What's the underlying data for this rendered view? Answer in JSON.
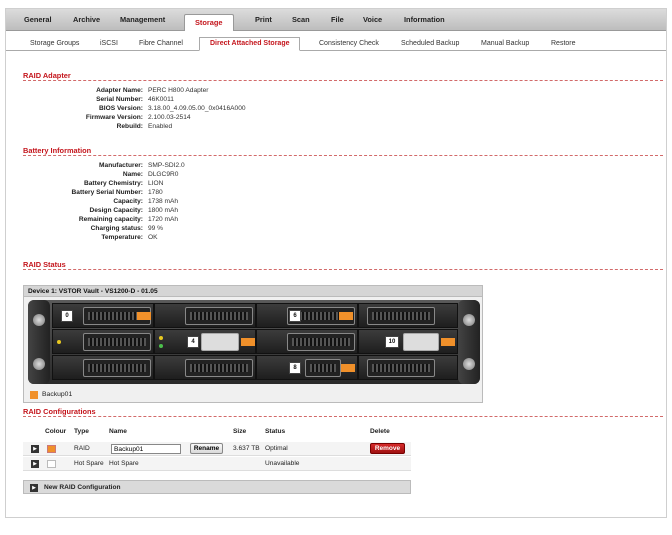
{
  "topnav": {
    "tabs": [
      "General",
      "Archive",
      "Management",
      "Storage",
      "Print",
      "Scan",
      "File",
      "Voice",
      "Information"
    ],
    "active": "Storage"
  },
  "subnav": {
    "tabs": [
      "Storage Groups",
      "iSCSI",
      "Fibre Channel",
      "Direct Attached Storage",
      "Consistency Check",
      "Scheduled Backup",
      "Manual Backup",
      "Restore"
    ],
    "active": "Direct Attached Storage"
  },
  "raid_adapter": {
    "title": "RAID Adapter",
    "rows": [
      {
        "label": "Adapter Name:",
        "value": "PERC H800 Adapter"
      },
      {
        "label": "Serial Number:",
        "value": "46K0011"
      },
      {
        "label": "BIOS Version:",
        "value": "3.18.00_4.09.05.00_0x0416A000"
      },
      {
        "label": "Firmware Version:",
        "value": "2.100.03-2514"
      },
      {
        "label": "Rebuild:",
        "value": "Enabled"
      }
    ]
  },
  "battery": {
    "title": "Battery Information",
    "rows": [
      {
        "label": "Manufacturer:",
        "value": "SMP-SDI2.0"
      },
      {
        "label": "Name:",
        "value": "DLGC9R0"
      },
      {
        "label": "Battery Chemistry:",
        "value": "LION"
      },
      {
        "label": "Battery Serial Number:",
        "value": "1780"
      },
      {
        "label": "Capacity:",
        "value": "1738 mAh"
      },
      {
        "label": "Design Capacity:",
        "value": "1800 mAh"
      },
      {
        "label": "Remaining capacity:",
        "value": "1720 mAh"
      },
      {
        "label": "Charging status:",
        "value": "99 %"
      },
      {
        "label": "Temperature:",
        "value": "OK"
      }
    ]
  },
  "raid_status": {
    "title": "RAID Status",
    "device": "Device 1: VSTOR Vault - VS1200-D - 01.05",
    "bay_labels": [
      "0",
      "6",
      "4",
      "10",
      "8"
    ],
    "legend": "Backup01",
    "accent": "#f0902a"
  },
  "raid_config": {
    "title": "RAID Configurations",
    "headers": {
      "colour": "Colour",
      "type": "Type",
      "name": "Name",
      "size": "Size",
      "status": "Status",
      "delete": "Delete"
    },
    "rows": [
      {
        "type": "RAID",
        "name": "Backup01",
        "size": "3.637 TB",
        "status": "Optimal",
        "rename": "Rename",
        "remove": "Remove"
      },
      {
        "type": "Hot Spare",
        "name": "Hot Spare",
        "size": "",
        "status": "Unavailable"
      }
    ],
    "new_label": "New RAID Configuration"
  },
  "colors": {
    "brand": "#c4151c",
    "bay_orange": "#f0902a"
  }
}
